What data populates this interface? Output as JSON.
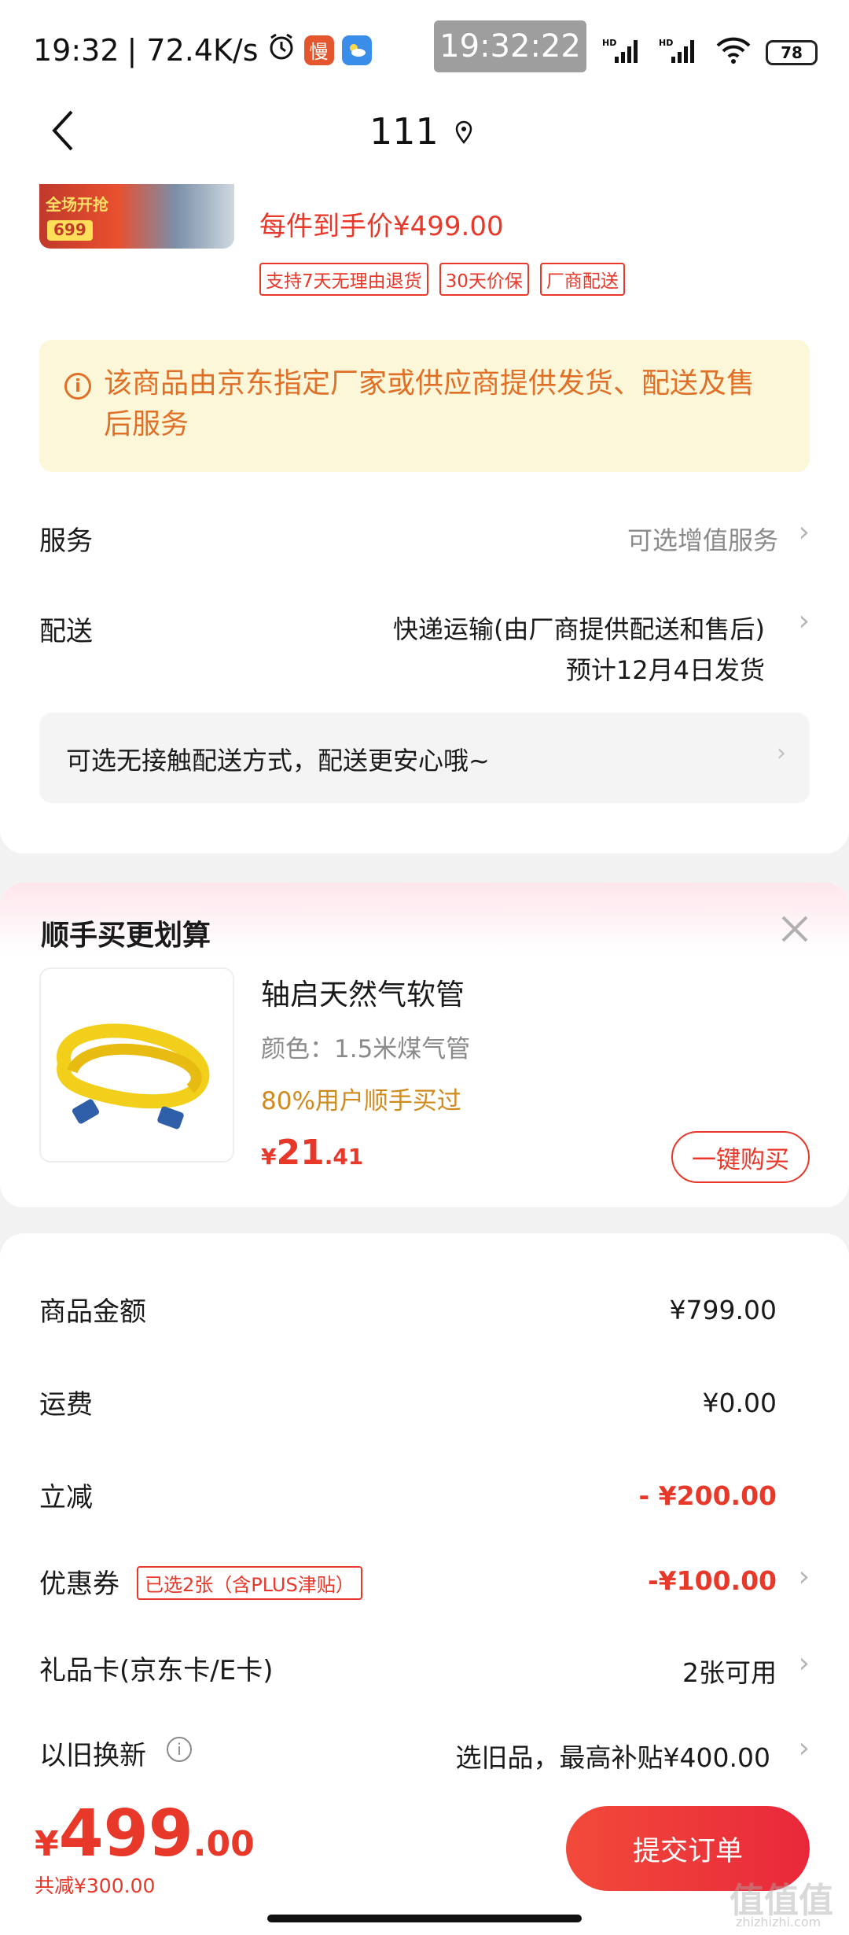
{
  "status_bar": {
    "time": "19:32",
    "net_speed": "| 72.4K/s",
    "app_icon_label": "慢",
    "clock_overlay": "19:32:22",
    "battery": "78"
  },
  "header": {
    "title": "111"
  },
  "product": {
    "thumb_line1": "全场开抢",
    "thumb_line2": "699",
    "price_line": "每件到手价¥499.00",
    "tags": [
      "支持7天无理由退货",
      "30天价保",
      "厂商配送"
    ]
  },
  "notice": {
    "text": "该商品由京东指定厂家或供应商提供发货、配送及售后服务"
  },
  "service": {
    "label": "服务",
    "value": "可选增值服务"
  },
  "delivery": {
    "label": "配送",
    "value_line1": "快递运输(由厂商提供配送和售后)",
    "value_line2": "预计12月4日发货"
  },
  "contactless": {
    "text": "可选无接触配送方式，配送更安心哦~"
  },
  "bundle": {
    "title": "顺手买更划算",
    "name": "轴启天然气软管",
    "color": "颜色：1.5米煤气管",
    "popularity": "80%用户顺手买过",
    "price_symbol": "¥",
    "price_int": "21",
    "price_dec": ".41",
    "buy_label": "一键购买"
  },
  "summary": {
    "goods": {
      "label": "商品金额",
      "value": "¥799.00"
    },
    "shipping": {
      "label": "运费",
      "value": "¥0.00"
    },
    "discount": {
      "label": "立减",
      "value": "- ¥200.00"
    },
    "coupon": {
      "label": "优惠券",
      "tag": "已选2张（含PLUS津贴）",
      "value": "-¥100.00"
    },
    "giftcard": {
      "label": "礼品卡(京东卡/E卡)",
      "value": "2张可用"
    },
    "tradein": {
      "label": "以旧换新",
      "value": "选旧品，最高补贴¥400.00"
    }
  },
  "footer": {
    "total_symbol": "¥",
    "total_int": "499",
    "total_dec": ".00",
    "saved": "共减¥300.00",
    "submit_label": "提交订单"
  },
  "watermark": {
    "text": "值值值",
    "sub": "zhizhizhi.com"
  },
  "colors": {
    "accent": "#e8382a",
    "notice_bg": "#fdf7d9",
    "notice_text": "#e07028",
    "orange_text": "#d08a1e"
  }
}
